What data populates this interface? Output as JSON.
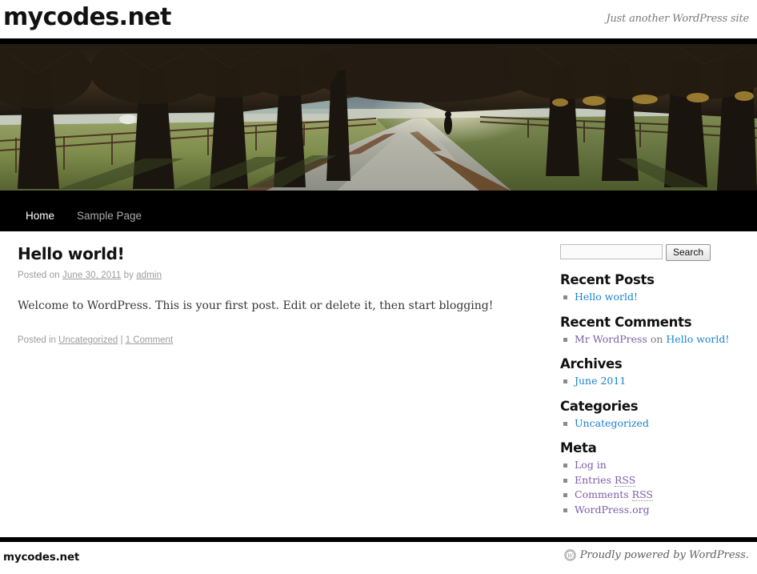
{
  "site": {
    "title": "mycodes.net",
    "description": "Just another WordPress site"
  },
  "header_image": {
    "name": "lanes-header-image",
    "alt": "Tree-lined lane with fence, field and a lone walker"
  },
  "nav": {
    "items": [
      {
        "label": "Home",
        "current": true
      },
      {
        "label": "Sample Page",
        "current": false
      }
    ]
  },
  "post": {
    "title": "Hello world!",
    "meta_posted_on": "Posted on ",
    "date": "June 30, 2011",
    "meta_by": " by ",
    "author": "admin",
    "content": "Welcome to WordPress. This is your first post. Edit or delete it, then start blogging!",
    "footer_posted_in": "Posted in ",
    "category": "Uncategorized",
    "separator": " | ",
    "comments": "1 Comment"
  },
  "search": {
    "value": "",
    "placeholder": "",
    "button_label": "Search"
  },
  "widgets": {
    "recent_posts": {
      "title": "Recent Posts",
      "items": [
        {
          "label": "Hello world!"
        }
      ]
    },
    "recent_comments": {
      "title": "Recent Comments",
      "items": [
        {
          "author": "Mr WordPress",
          "on": " on ",
          "post": "Hello world!"
        }
      ]
    },
    "archives": {
      "title": "Archives",
      "items": [
        {
          "label": "June 2011"
        }
      ]
    },
    "categories": {
      "title": "Categories",
      "items": [
        {
          "label": "Uncategorized"
        }
      ]
    },
    "meta": {
      "title": "Meta",
      "items": [
        {
          "label": "Log in",
          "abbr": ""
        },
        {
          "label": "Entries ",
          "abbr": "RSS"
        },
        {
          "label": "Comments ",
          "abbr": "RSS"
        },
        {
          "label": "WordPress.org",
          "abbr": ""
        }
      ]
    }
  },
  "footer": {
    "site_title": "mycodes.net",
    "credit": "Proudly powered by WordPress."
  },
  "colors": {
    "link_blue": "#1982d1",
    "link_visited": "#7b5ea7",
    "text": "#373737",
    "muted": "#9b9b9b",
    "nav_bg": "#000000"
  }
}
